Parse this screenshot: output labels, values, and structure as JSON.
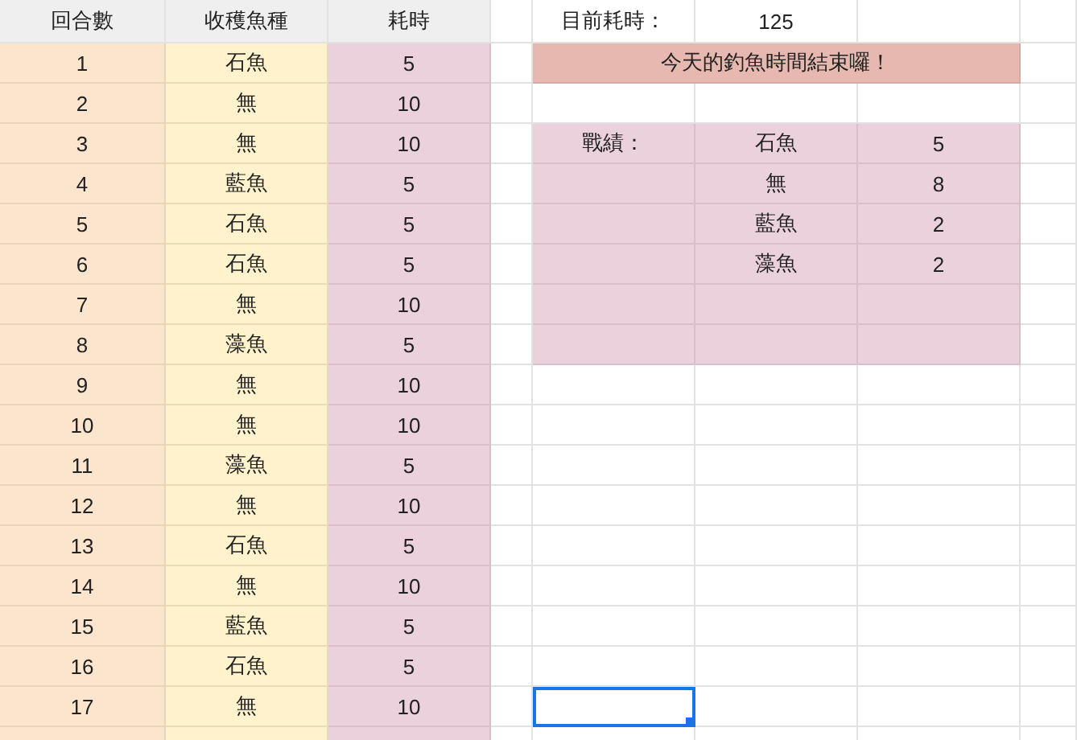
{
  "columns": [
    "回合數",
    "收穫魚種",
    "耗時"
  ],
  "rows": [
    {
      "round": "1",
      "fish": "石魚",
      "time": "5",
      "selected": false
    },
    {
      "round": "2",
      "fish": "無",
      "time": "10",
      "selected": false
    },
    {
      "round": "3",
      "fish": "無",
      "time": "10",
      "selected": false
    },
    {
      "round": "4",
      "fish": "藍魚",
      "time": "5",
      "selected": false
    },
    {
      "round": "5",
      "fish": "石魚",
      "time": "5",
      "selected": false
    },
    {
      "round": "6",
      "fish": "石魚",
      "time": "5",
      "selected": false
    },
    {
      "round": "7",
      "fish": "無",
      "time": "10",
      "selected": false
    },
    {
      "round": "8",
      "fish": "藻魚",
      "time": "5",
      "selected": false
    },
    {
      "round": "9",
      "fish": "無",
      "time": "10",
      "selected": false
    },
    {
      "round": "10",
      "fish": "無",
      "time": "10",
      "selected": false
    },
    {
      "round": "11",
      "fish": "藻魚",
      "time": "5",
      "selected": false
    },
    {
      "round": "12",
      "fish": "無",
      "time": "10",
      "selected": false
    },
    {
      "round": "13",
      "fish": "石魚",
      "time": "5",
      "selected": false
    },
    {
      "round": "14",
      "fish": "無",
      "time": "10",
      "selected": false
    },
    {
      "round": "15",
      "fish": "藍魚",
      "time": "5",
      "selected": false
    },
    {
      "round": "16",
      "fish": "石魚",
      "time": "5",
      "selected": false
    },
    {
      "round": "17",
      "fish": "無",
      "time": "10",
      "selected": true
    }
  ],
  "current_time": {
    "label": "目前耗時：",
    "value": "125"
  },
  "banner": "今天的釣魚時間結束囉！",
  "results": {
    "label": "戰績：",
    "rows": [
      {
        "fish": "石魚",
        "count": "5"
      },
      {
        "fish": "無",
        "count": "8"
      },
      {
        "fish": "藍魚",
        "count": "2"
      },
      {
        "fish": "藻魚",
        "count": "2"
      }
    ]
  }
}
